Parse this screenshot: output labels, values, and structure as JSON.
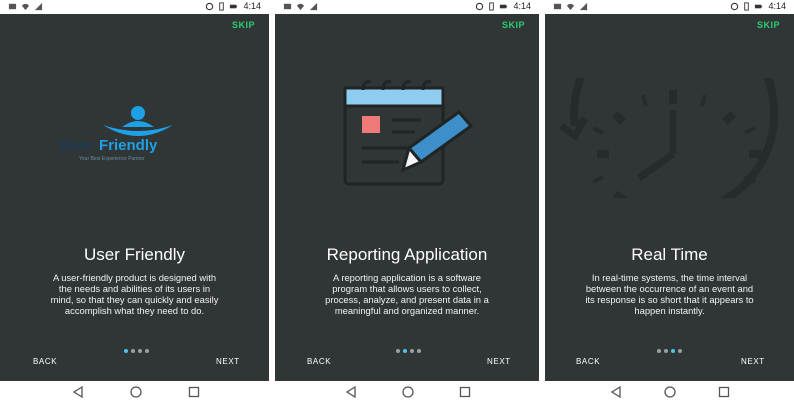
{
  "status_time": "4:14",
  "skip_label": "SKIP",
  "back_label": "BACK",
  "next_label": "NEXT",
  "screens": [
    {
      "title": "User Friendly",
      "description_lines": [
        "A user-friendly product is designed with",
        "the needs and abilities of its users in",
        "mind, so that they can quickly and easily",
        "accomplish what they need to do."
      ],
      "logo_text_user": "User",
      "logo_text_friendly": "Friendly",
      "logo_tagline": "Your Best Experience Partner",
      "active_dot": 0
    },
    {
      "title": "Reporting Application",
      "description_lines": [
        "A reporting application is a software",
        "program that allows users to collect,",
        "process, analyze, and present data in a",
        "meaningful and organized manner."
      ],
      "active_dot": 1
    },
    {
      "title": "Real Time",
      "description_lines": [
        "In real-time systems, the time interval",
        "between the occurrence of an event and",
        "its response is so short that it appears to",
        "happen instantly."
      ],
      "active_dot": 2
    }
  ],
  "colors": {
    "screen_bg": "#303535",
    "accent_green": "#2ecc71",
    "accent_blue": "#4fc3e8",
    "logo_blue": "#1ea0e6"
  },
  "icons": {
    "status_left": [
      "messages-icon",
      "wifi-icon",
      "signal-icon"
    ],
    "status_right": [
      "alarm-icon",
      "vibrate-icon",
      "battery-icon"
    ],
    "nav": [
      "back-triangle-icon",
      "home-circle-icon",
      "recents-square-icon"
    ]
  }
}
